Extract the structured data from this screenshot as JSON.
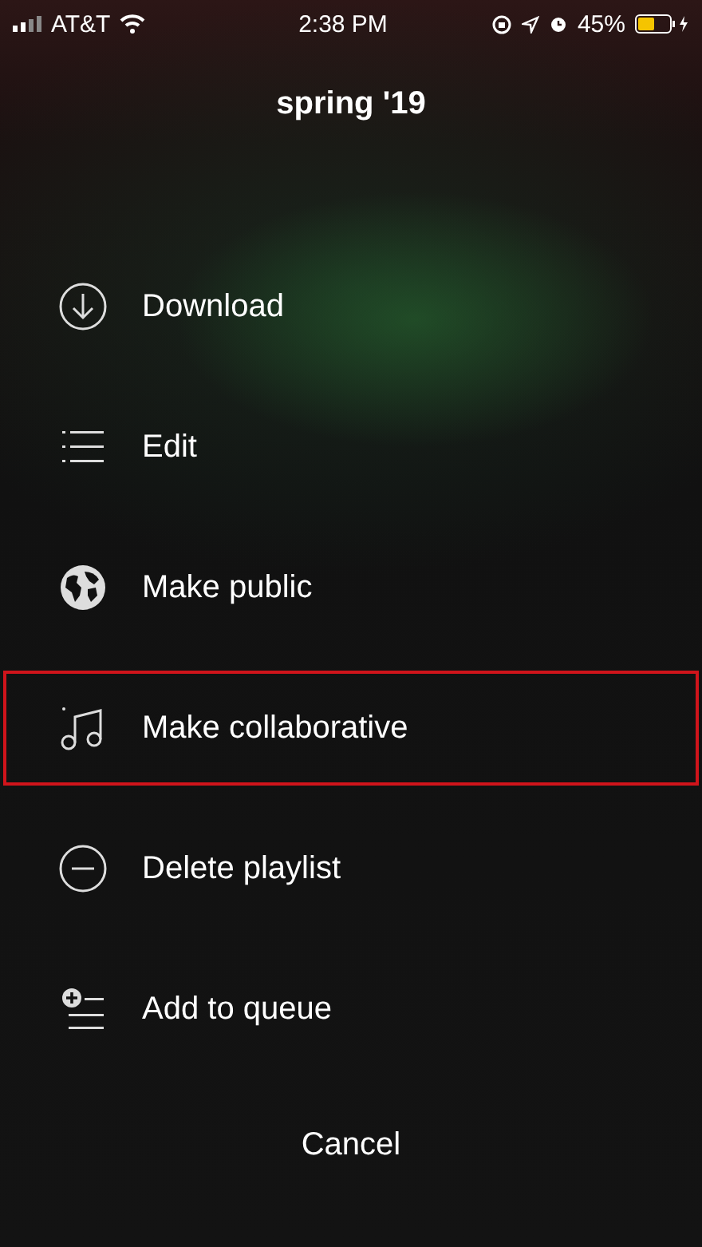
{
  "status_bar": {
    "carrier": "AT&T",
    "time": "2:38 PM",
    "battery": "45%"
  },
  "title": "spring '19",
  "menu": [
    {
      "kind": "download",
      "label": "Download",
      "highlighted": false
    },
    {
      "kind": "list",
      "label": "Edit",
      "highlighted": false
    },
    {
      "kind": "globe",
      "label": "Make public",
      "highlighted": false
    },
    {
      "kind": "music",
      "label": "Make collaborative",
      "highlighted": true
    },
    {
      "kind": "minus",
      "label": "Delete playlist",
      "highlighted": false
    },
    {
      "kind": "queue",
      "label": "Add to queue",
      "highlighted": false
    }
  ],
  "cancel": "Cancel"
}
